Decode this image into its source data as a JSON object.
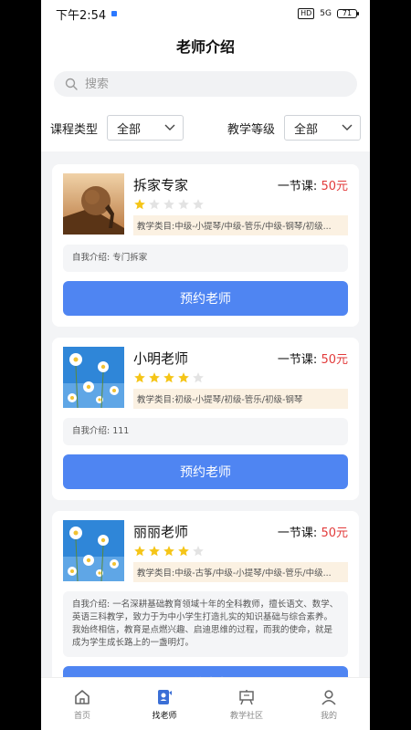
{
  "status_bar": {
    "time": "下午2:54",
    "network": "5G",
    "battery": "71"
  },
  "header": {
    "title": "老师介绍"
  },
  "search": {
    "placeholder": "搜索"
  },
  "filters": {
    "course_type": {
      "label": "课程类型",
      "value": "全部"
    },
    "teaching_level": {
      "label": "教学等级",
      "value": "全部"
    }
  },
  "teachers": [
    {
      "name": "拆家专家",
      "price_label": "一节课:",
      "price": "50元",
      "rating": 1,
      "subjects": "教学类目:中级-小提琴/中级-管乐/中级-钢琴/初级...",
      "intro": "自我介绍: 专门拆家",
      "button": "预约老师"
    },
    {
      "name": "小明老师",
      "price_label": "一节课:",
      "price": "50元",
      "rating": 4,
      "subjects": "教学类目:初级-小提琴/初级-管乐/初级-钢琴",
      "intro": "自我介绍: 111",
      "button": "预约老师"
    },
    {
      "name": "丽丽老师",
      "price_label": "一节课:",
      "price": "50元",
      "rating": 4,
      "subjects": "教学类目:中级-古筝/中级-小提琴/中级-管乐/中级...",
      "intro": "自我介绍: 一名深耕基础教育领域十年的全科教师，擅长语文、数学、英语三科教学，致力于为中小学生打造扎实的知识基础与综合素养。我始终相信，教育是点燃兴趣、启迪思维的过程，而我的使命，就是成为学生成长路上的一盏明灯。",
      "button": "预约老师"
    }
  ],
  "tabbar": {
    "home": "首页",
    "find_teacher": "找老师",
    "community": "教学社区",
    "mine": "我的"
  },
  "colors": {
    "accent": "#4f85f2",
    "price": "#e23b3b",
    "star": "#f5c518",
    "star_empty": "#e3e3e3"
  }
}
